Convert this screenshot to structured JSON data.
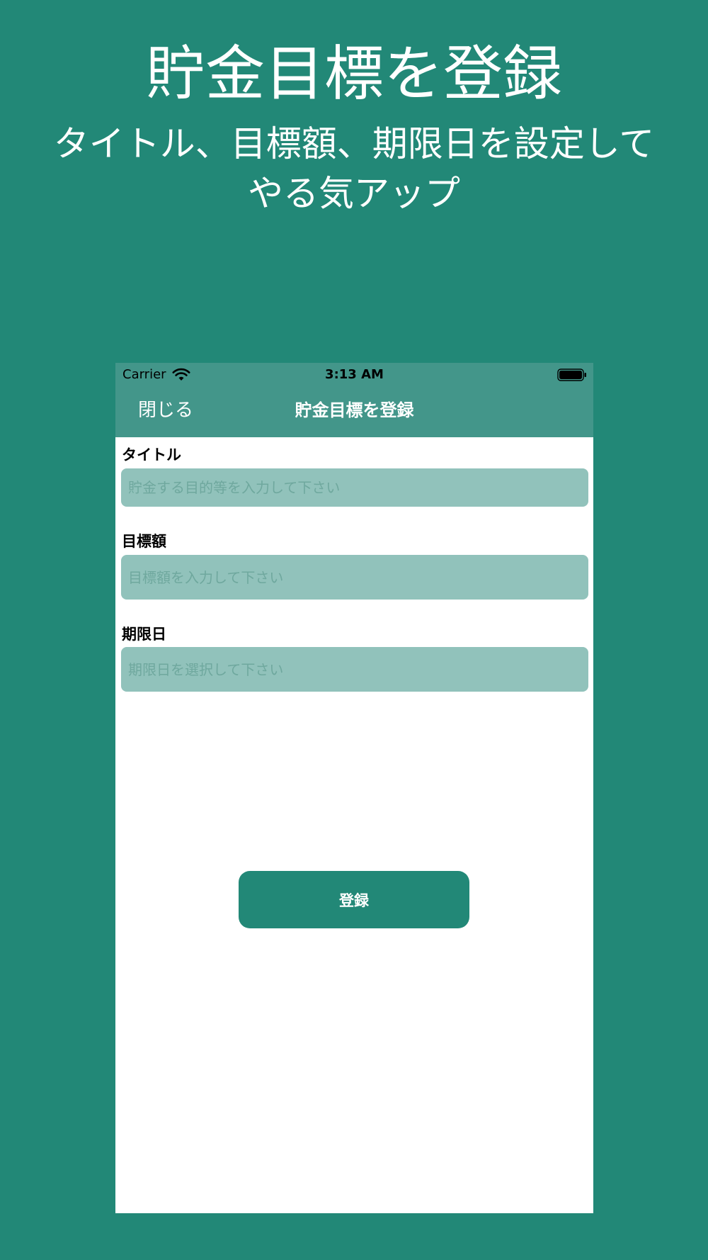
{
  "colors": {
    "background": "#228877",
    "nav_bar": "#43968a",
    "input_fill": "#91c2bb",
    "button": "#228877"
  },
  "promo": {
    "title": "貯金目標を登録",
    "subtitle": "タイトル、目標額、期限日を設定してやる気アップ"
  },
  "status_bar": {
    "carrier": "Carrier",
    "time": "3:13 AM",
    "wifi_icon": "wifi-icon",
    "battery_icon": "battery-icon"
  },
  "nav": {
    "close_label": "閉じる",
    "title": "貯金目標を登録"
  },
  "form": {
    "title_field": {
      "label": "タイトル",
      "value": "",
      "placeholder": "貯金する目的等を入力して下さい"
    },
    "amount_field": {
      "label": "目標額",
      "value": "",
      "placeholder": "目標額を入力して下さい"
    },
    "deadline_field": {
      "label": "期限日",
      "value": "",
      "placeholder": "期限日を選択して下さい"
    },
    "submit_label": "登録"
  }
}
